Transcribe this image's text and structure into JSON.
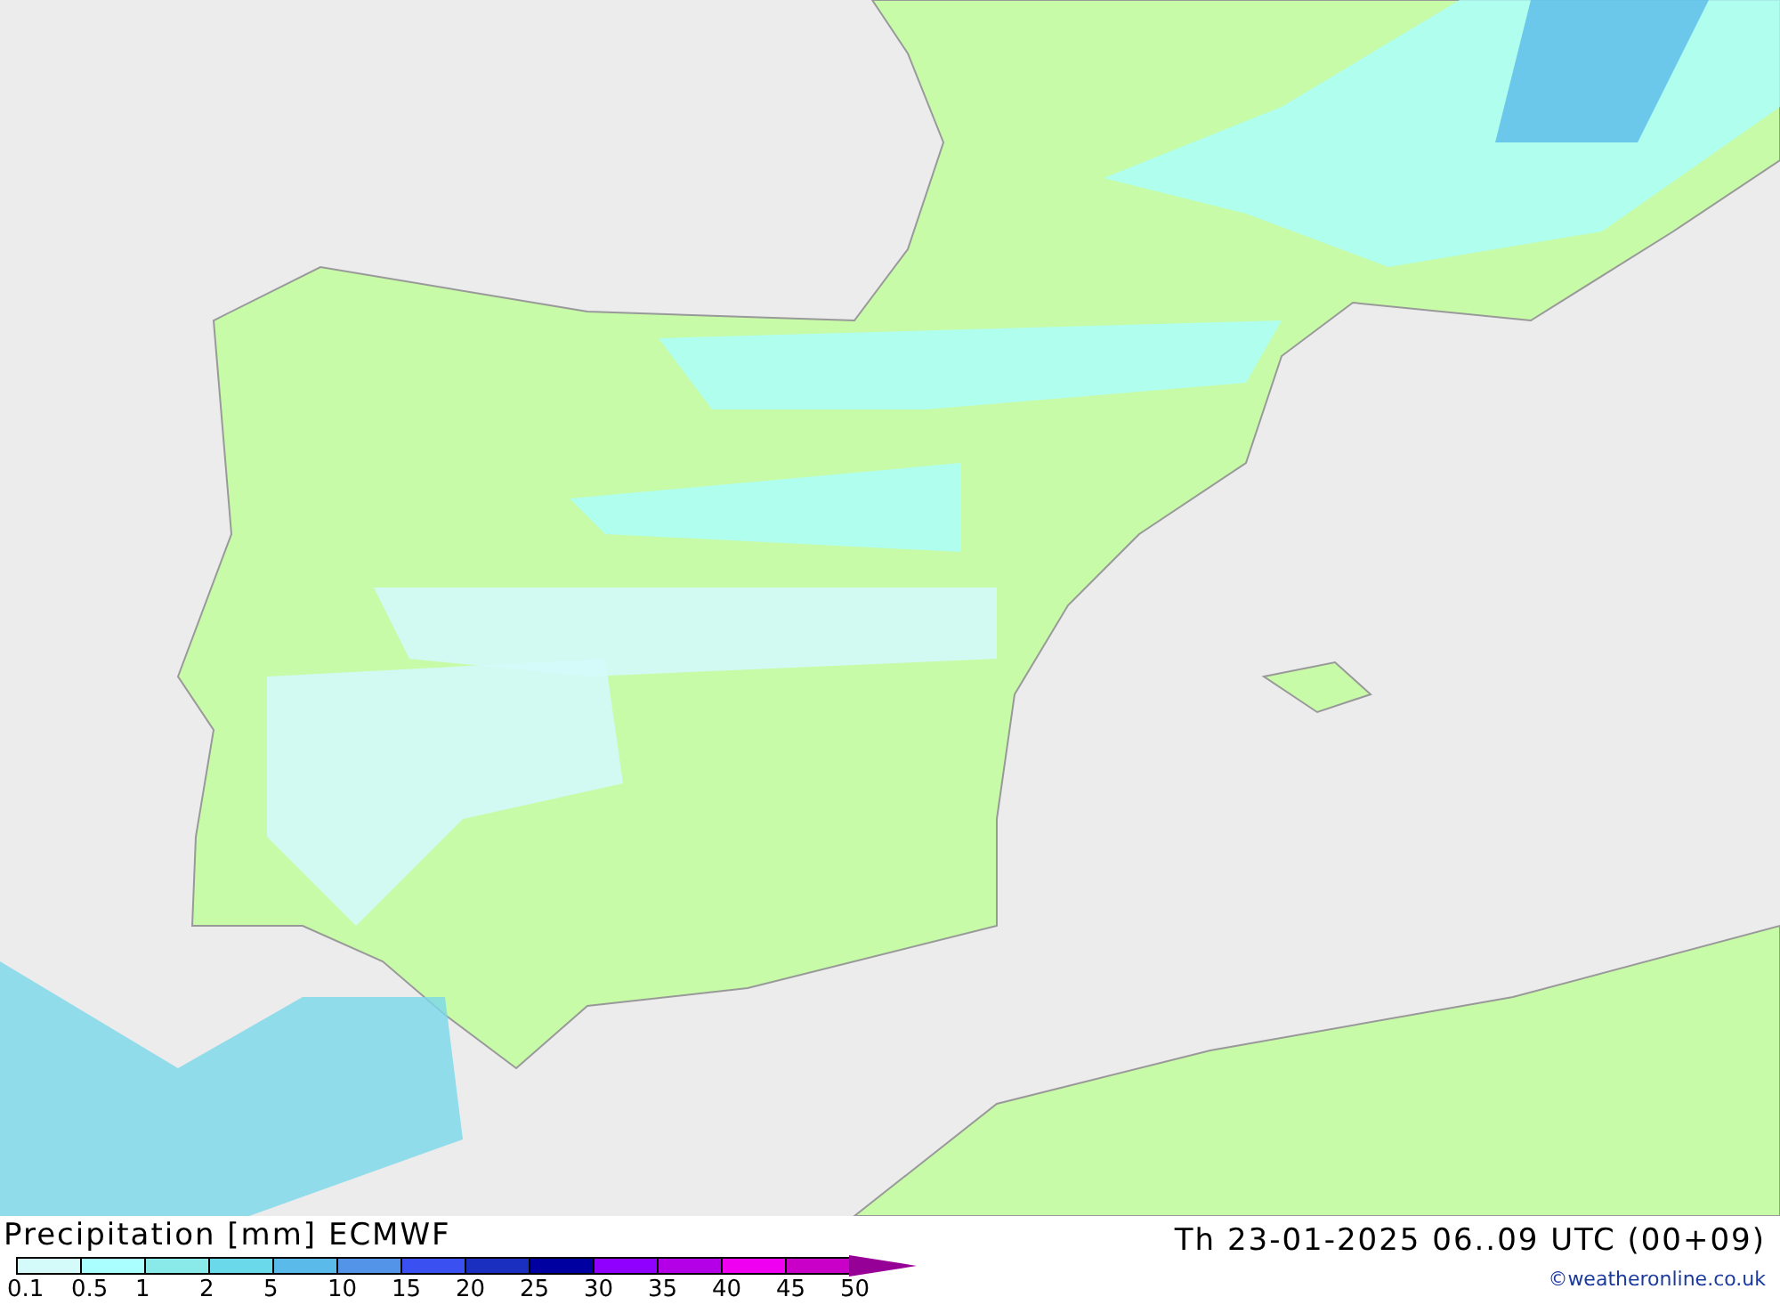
{
  "title": "Precipitation [mm] ECMWF",
  "valid_time": "Th 23-01-2025 06..09 UTC (00+09)",
  "legend": [
    {
      "label": "0.1",
      "color": "#d4fafa"
    },
    {
      "label": "0.5",
      "color": "#aaffff"
    },
    {
      "label": "1",
      "color": "#8aeaea"
    },
    {
      "label": "2",
      "color": "#6adaea"
    },
    {
      "label": "5",
      "color": "#5abaea"
    },
    {
      "label": "10",
      "color": "#5494e8"
    },
    {
      "label": "15",
      "color": "#3a50f0"
    },
    {
      "label": "20",
      "color": "#1a2ec0"
    },
    {
      "label": "25",
      "color": "#0000a0"
    },
    {
      "label": "30",
      "color": "#9000ff"
    },
    {
      "label": "35",
      "color": "#b400e6"
    },
    {
      "label": "40",
      "color": "#f000f0"
    },
    {
      "label": "45",
      "color": "#c800c8"
    },
    {
      "label": "50",
      "color": "#960096"
    }
  ],
  "credit": "©weatheronline.co.uk"
}
